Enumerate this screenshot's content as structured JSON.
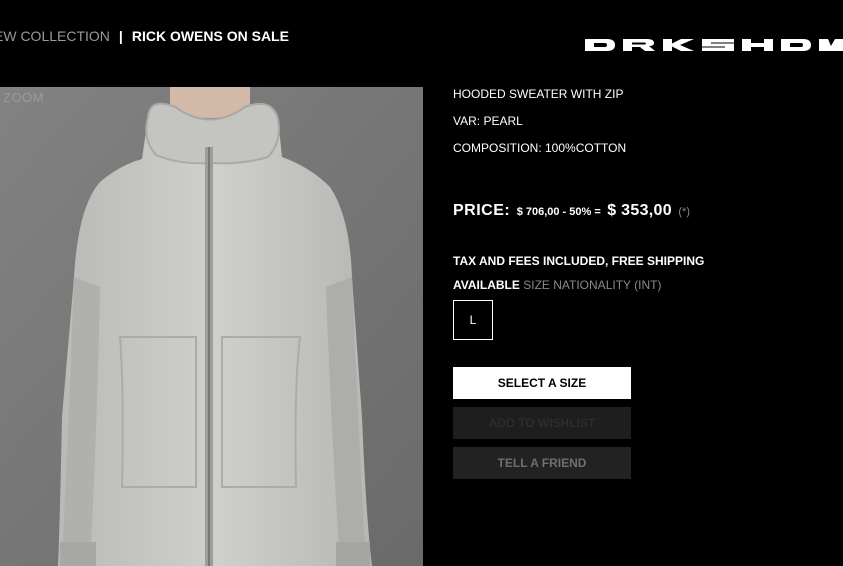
{
  "nav": {
    "new_collection": "EW COLLECTION",
    "separator": "|",
    "sale": "RICK OWENS ON SALE"
  },
  "logo": {
    "text": "DRKSHDW"
  },
  "image": {
    "zoom_label": "ZOOM",
    "subject": "hooded-sweater-photo"
  },
  "product": {
    "name": "HOODED SWEATER WITH ZIP",
    "variant": "VAR: PEARL",
    "composition": "COMPOSITION: 100%COTTON"
  },
  "price": {
    "label": "PRICE:",
    "calc": "$ 706,00 - 50% =",
    "final": "$ 353,00",
    "note": "(*)"
  },
  "shipping": "TAX AND FEES INCLUDED, FREE SHIPPING",
  "availability": {
    "label": "AVAILABLE",
    "size_info": "SIZE NATIONALITY (INT)",
    "sizes": [
      "L"
    ]
  },
  "buttons": {
    "select_size": "SELECT A SIZE",
    "wishlist": "ADD TO WISHLIST",
    "tell_friend": "TELL A FRIEND"
  },
  "colors": {
    "background": "#000000",
    "primary_button": "#ffffff",
    "muted_text": "#8a8a8a",
    "hoodie": "#c8c9c5"
  }
}
